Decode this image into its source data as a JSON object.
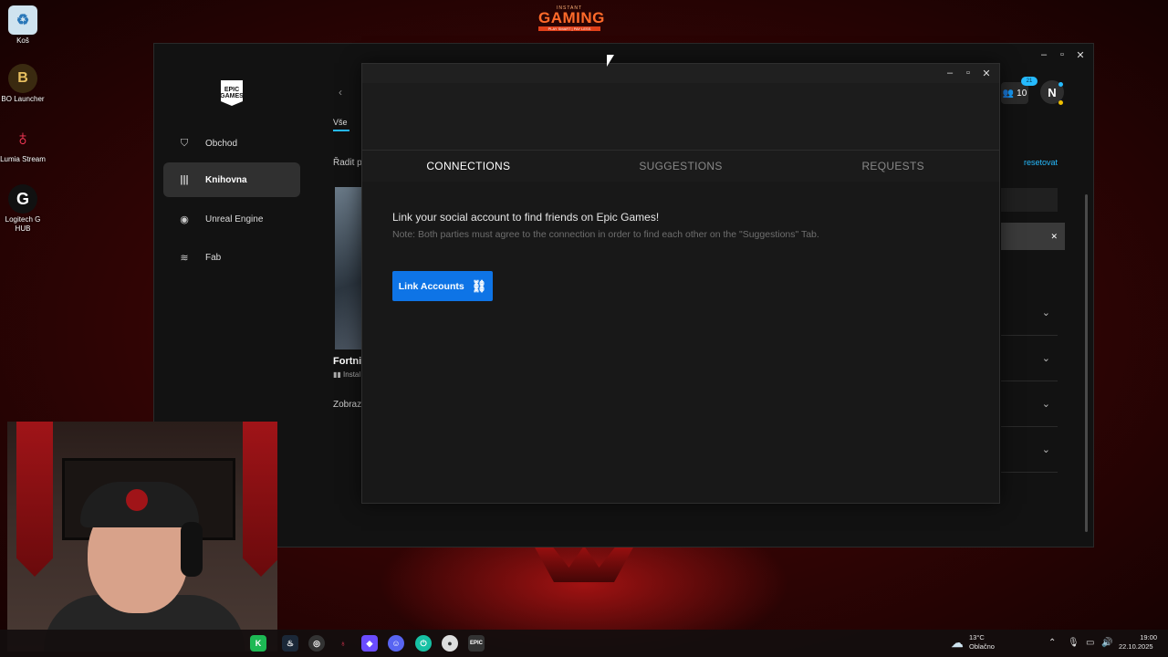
{
  "desktop": {
    "icons": [
      {
        "label": "Koš",
        "icon": "recycle-bin-icon"
      },
      {
        "label": "BO Launcher",
        "icon": "bo-launcher-icon"
      },
      {
        "label": "Lumia Stream",
        "icon": "lumia-stream-icon"
      },
      {
        "label": "Logitech G HUB",
        "icon": "logitech-ghub-icon"
      }
    ],
    "wallpaper_logo": {
      "small": "INSTANT",
      "big": "GAMING",
      "tag": "PLAY SMART | PAY LESS"
    }
  },
  "launcher": {
    "logo": "EPIC GAMES",
    "nav": [
      {
        "label": "Obchod",
        "icon": "shopping-bag-icon",
        "active": false
      },
      {
        "label": "Knihovna",
        "icon": "library-icon",
        "active": true
      },
      {
        "label": "Unreal Engine",
        "icon": "unreal-engine-icon",
        "active": false
      },
      {
        "label": "Fab",
        "icon": "fab-icon",
        "active": false
      }
    ],
    "fragments": {
      "sort": "Řadit p",
      "game": "Fortnit",
      "install": "Instal",
      "show": "Zobraz",
      "tab_partial": "Vše",
      "reset": "resetovat"
    },
    "friends_count": "10",
    "notifications": "21",
    "avatar_initial": "N"
  },
  "modal": {
    "tabs": [
      {
        "label": "CONNECTIONS",
        "active": true
      },
      {
        "label": "SUGGESTIONS",
        "active": false
      },
      {
        "label": "REQUESTS",
        "active": false
      }
    ],
    "title": "Link your social account to find friends on Epic Games!",
    "note": "Note: Both parties must agree to the connection in order to find each other on the \"Suggestions\" Tab.",
    "button_label": "Link Accounts"
  },
  "taskbar": {
    "weather_temp": "13°C",
    "weather_desc": "Oblačno",
    "time": "19:00",
    "date": "22.10.2025"
  },
  "colors": {
    "accent": "#0e74e6",
    "epic_blue": "#26bbff"
  }
}
